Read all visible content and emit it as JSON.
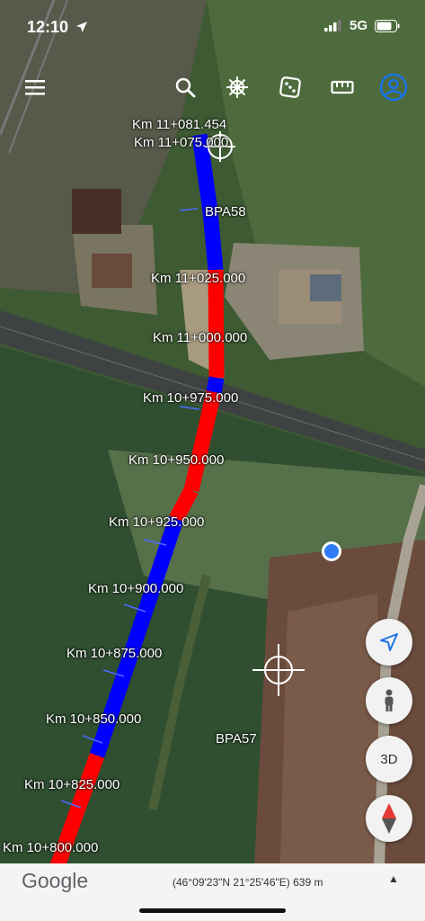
{
  "status_bar": {
    "time": "12:10",
    "network": "5G"
  },
  "toolbar": {
    "icons": [
      "menu-icon",
      "search-icon",
      "helm-icon",
      "dice-icon",
      "ruler-icon",
      "account-icon"
    ],
    "accent": "#1a73e8"
  },
  "map": {
    "kilometer_labels": [
      "Km 11+081.454",
      "Km 11+075.000",
      "Km 11+025.000",
      "Km 11+000.000",
      "Km 10+975.000",
      "Km 10+950.000",
      "Km 10+925.000",
      "Km 10+900.000",
      "Km 10+875.000",
      "Km 10+850.000",
      "Km 10+825.000",
      "Km 10+800.000"
    ],
    "markers": [
      "BPA58",
      "BPA57"
    ],
    "route_colors": {
      "blue": "#0000ff",
      "red": "#ff0000"
    }
  },
  "controls": {
    "three_d_label": "3D"
  },
  "bottom_bar": {
    "logo": "Google",
    "coordinates": "(46°09'23\"N 21°25'46\"E) 639 m",
    "expand_glyph": "▲"
  }
}
